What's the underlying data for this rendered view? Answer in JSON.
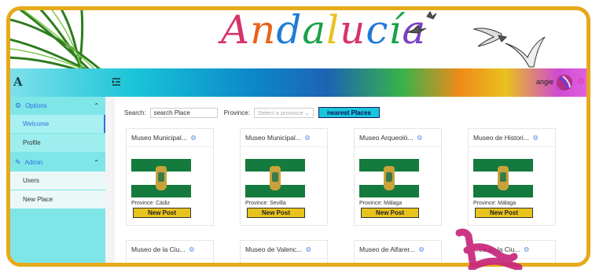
{
  "banner": {
    "title": "Andalucía",
    "title_letters": [
      {
        "ch": "A",
        "color": "#d6336c"
      },
      {
        "ch": "n",
        "color": "#e8631c"
      },
      {
        "ch": "d",
        "color": "#1f7bd6"
      },
      {
        "ch": "a",
        "color": "#19a14a"
      },
      {
        "ch": "l",
        "color": "#e8c21f"
      },
      {
        "ch": "u",
        "color": "#d6336c"
      },
      {
        "ch": "c",
        "color": "#1f7bd6"
      },
      {
        "ch": "í",
        "color": "#19a14a"
      },
      {
        "ch": "a",
        "color": "#7a3fc8"
      }
    ]
  },
  "topbar": {
    "logo": "A",
    "user_name": "angie",
    "menu_icon": "menu-fold-icon",
    "settings_icon": "gear-icon"
  },
  "sidebar": {
    "options_label": "Options",
    "options_icon": "gear-icon",
    "options_items": [
      "Welcome",
      "Profile"
    ],
    "admin_label": "Admin",
    "admin_icon": "edit-icon",
    "admin_items": [
      "Users",
      "New Place"
    ]
  },
  "search": {
    "label": "Search:",
    "value": "search Place",
    "province_label": "Province:",
    "province_placeholder": "Select a province",
    "nearest_label": "nearest Places"
  },
  "cards": [
    {
      "title": "Museo Municipal...",
      "province": "Province: Cádiz",
      "button": "New Post"
    },
    {
      "title": "Museo Municipal...",
      "province": "Province: Sevilla",
      "button": "New Post"
    },
    {
      "title": "Museo Arqueoló...",
      "province": "Province: Málaga",
      "button": "New Post"
    },
    {
      "title": "Museo de Histori...",
      "province": "Province: Málaga",
      "button": "New Post"
    },
    {
      "title": "Museo de la Ciu...",
      "province": "",
      "button": ""
    },
    {
      "title": "Museo de Valenc...",
      "province": "",
      "button": ""
    },
    {
      "title": "Museo de Alfarer...",
      "province": "",
      "button": ""
    },
    {
      "title": "...eo de la Ciu...",
      "province": "",
      "button": ""
    }
  ],
  "colors": {
    "accent": "#2f6ee0",
    "sidebar_bg": "#7fe6e8",
    "button_yellow": "#e8c31b",
    "nearest_button": "#19c6dc",
    "frame_border": "#e5a91b",
    "flag_green": "#157a3d"
  }
}
